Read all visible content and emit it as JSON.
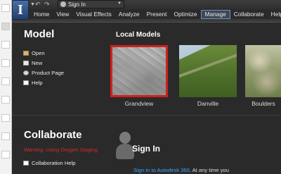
{
  "topbar": {
    "logo_letter": "I",
    "undo_symbol": "↶",
    "redo_symbol": "↷",
    "signin_label": "Sign In"
  },
  "tabs": [
    {
      "label": "Home"
    },
    {
      "label": "View"
    },
    {
      "label": "Visual Effects"
    },
    {
      "label": "Analyze"
    },
    {
      "label": "Present"
    },
    {
      "label": "Optimize"
    },
    {
      "label": "Manage",
      "active": true
    },
    {
      "label": "Collaborate"
    },
    {
      "label": "Help"
    }
  ],
  "model": {
    "title": "Model",
    "items": [
      {
        "label": "Open",
        "icon": "folder-icon"
      },
      {
        "label": "New",
        "icon": "new-document-icon"
      },
      {
        "label": "Product Page",
        "icon": "globe-icon"
      },
      {
        "label": "Help",
        "icon": "help-icon"
      }
    ]
  },
  "local_models": {
    "title": "Local Models",
    "items": [
      {
        "label": "Grandview",
        "selected": true
      },
      {
        "label": "Danville"
      },
      {
        "label": "Boulders"
      }
    ]
  },
  "collaborate": {
    "title": "Collaborate",
    "warning": "Warning: Using Oxygen Staging",
    "help_label": "Collaboration Help"
  },
  "signin": {
    "title": "Sign In",
    "link_text": "Sign in to Autodesk 360",
    "rest_text": ". At any time you"
  },
  "colors": {
    "background": "#2b2b2b",
    "accent_red": "#d0201c",
    "link_blue": "#3ea6ff",
    "warning_red": "#d12b2b"
  }
}
